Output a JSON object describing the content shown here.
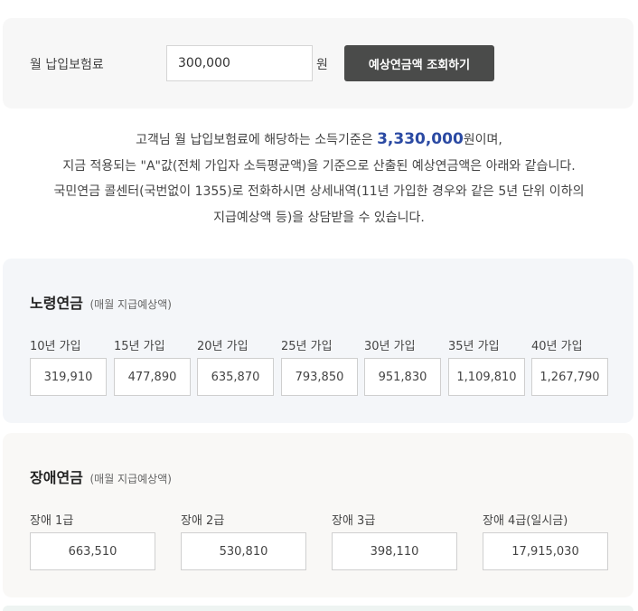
{
  "input": {
    "label": "월 납입보험료",
    "value": "300,000",
    "unit": "원",
    "button_label": "예상연금액 조회하기"
  },
  "description": {
    "line1_before": "고객님 월 납입보험료에 해당하는 소득기준은 ",
    "line1_amount": "3,330,000",
    "line1_after": "원이며,",
    "line2": "지금 적용되는 \"A\"값(전체 가입자 소득평균액)을 기준으로 산출된 예상연금액은 아래와 같습니다.",
    "line3": "국민연금 콜센터(국번없이 1355)로 전화하시면 상세내역(11년 가입한 경우와 같은 5년 단위 이하의",
    "line4": "지급예상액 등)을 상담받을 수 있습니다."
  },
  "old_age": {
    "title": "노령연금",
    "subtitle": "(매월 지급예상액)",
    "items": [
      {
        "label": "10년 가입",
        "value": "319,910"
      },
      {
        "label": "15년 가입",
        "value": "477,890"
      },
      {
        "label": "20년 가입",
        "value": "635,870"
      },
      {
        "label": "25년 가입",
        "value": "793,850"
      },
      {
        "label": "30년 가입",
        "value": "951,830"
      },
      {
        "label": "35년 가입",
        "value": "1,109,810"
      },
      {
        "label": "40년 가입",
        "value": "1,267,790"
      }
    ]
  },
  "disability": {
    "title": "장애연금",
    "subtitle": "(매월 지급예상액)",
    "items": [
      {
        "label": "장애 1급",
        "value": "663,510"
      },
      {
        "label": "장애 2급",
        "value": "530,810"
      },
      {
        "label": "장애 3급",
        "value": "398,110"
      },
      {
        "label": "장애 4급(일시금)",
        "value": "17,915,030"
      }
    ]
  }
}
